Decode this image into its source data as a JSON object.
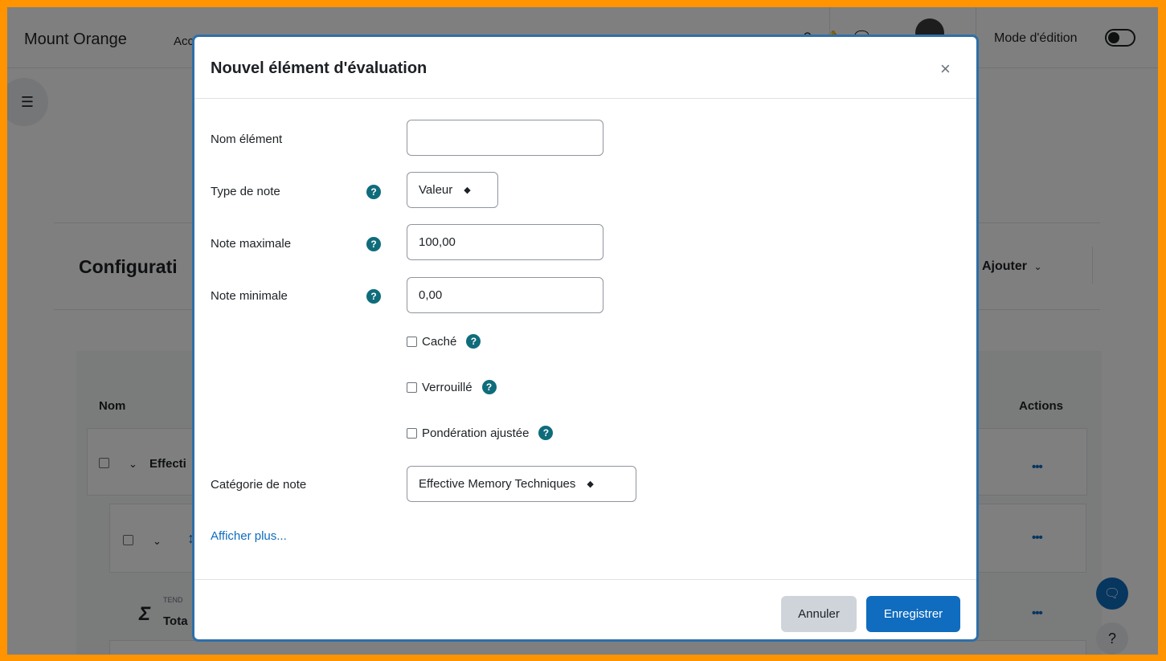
{
  "header": {
    "brand": "Mount Orange",
    "nav_partial": "Acc",
    "edit_mode_label": "Mode d'édition"
  },
  "page": {
    "heading_partial": "Configurati",
    "add_button": "Ajouter",
    "table": {
      "col_name": "Nom",
      "col_actions": "Actions",
      "row1_text": "Effecti",
      "row3_small": "TEND",
      "row3_text": "Tota",
      "actions_glyph": "•••"
    }
  },
  "modal": {
    "title": "Nouvel élément d'évaluation",
    "close_glyph": "×",
    "fields": {
      "name_label": "Nom élément",
      "name_value": "",
      "grade_type_label": "Type de note",
      "grade_type_value": "Valeur",
      "max_label": "Note maximale",
      "max_value": "100,00",
      "min_label": "Note minimale",
      "min_value": "0,00",
      "hidden_label": "Caché",
      "locked_label": "Verrouillé",
      "weight_label": "Pondération ajustée",
      "category_label": "Catégorie de note",
      "category_value": "Effective Memory Techniques"
    },
    "help_glyph": "?",
    "show_more": "Afficher plus...",
    "cancel_button": "Annuler",
    "save_button": "Enregistrer"
  },
  "colors": {
    "accent": "#0f6cbf",
    "help_icon": "#0f6c7b",
    "frame_border": "#ff9300",
    "modal_border": "#2f6fa8"
  },
  "icons": [
    "search-icon",
    "bell-icon",
    "chat-icon",
    "drawer-toggle-icon",
    "chevron-down-icon",
    "move-icon",
    "sigma-icon",
    "help-icon",
    "close-icon",
    "select-arrow-icon"
  ]
}
